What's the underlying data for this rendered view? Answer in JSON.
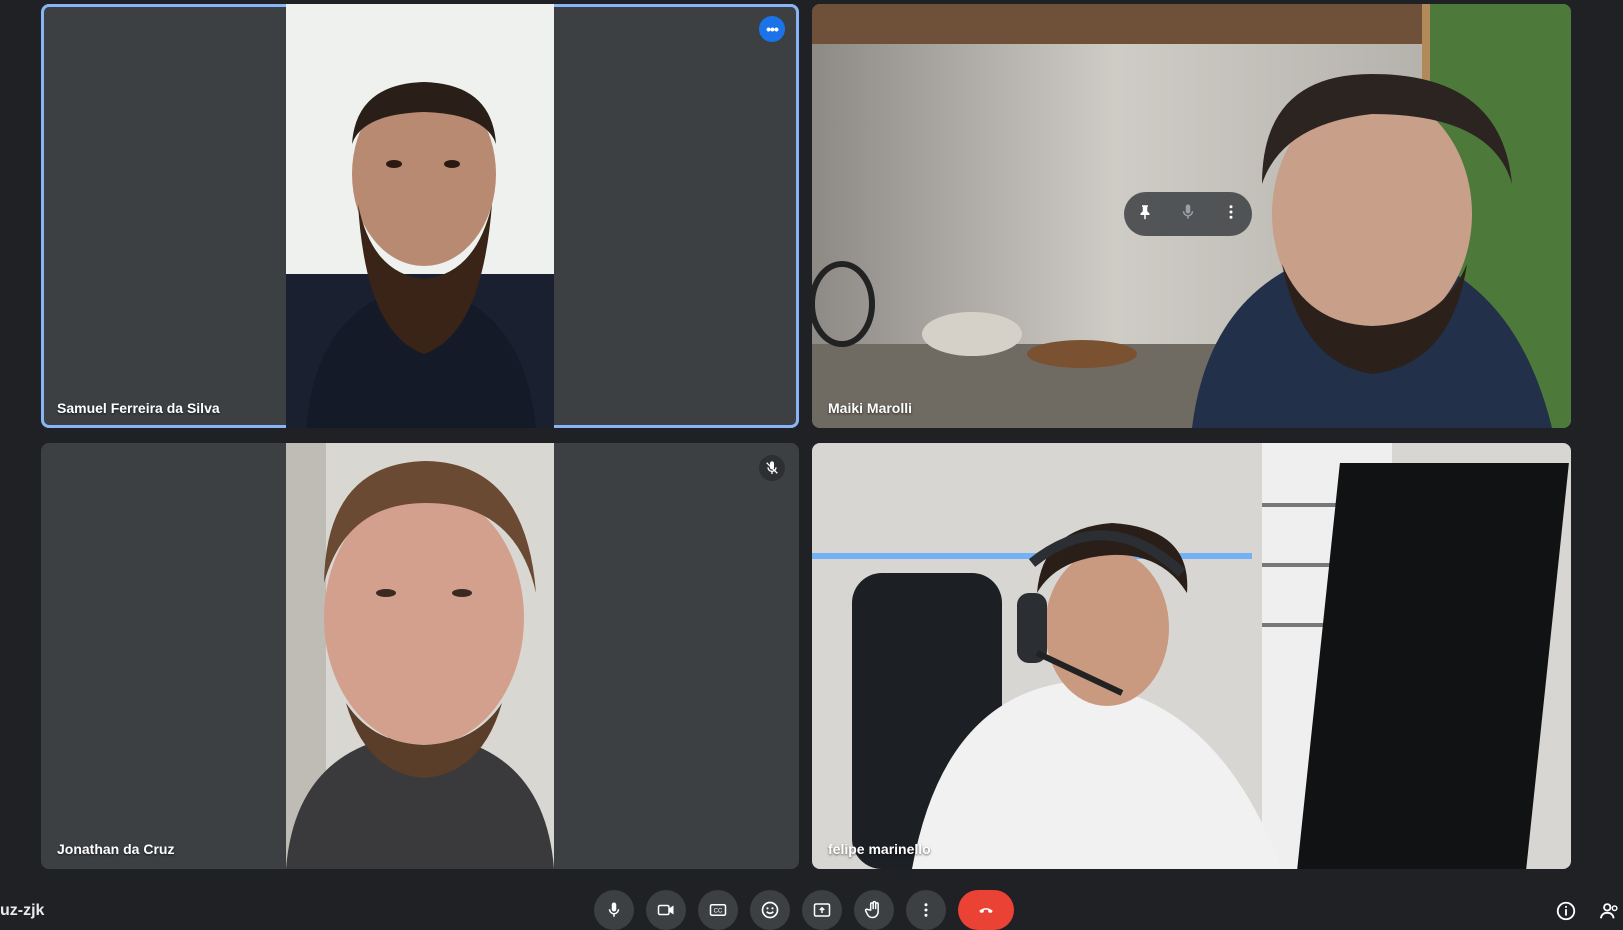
{
  "meeting": {
    "code_suffix": "uz-zjk"
  },
  "participants": [
    {
      "name": "Samuel Ferreira da Silva",
      "active_speaker": true,
      "more_options": "•••"
    },
    {
      "name": "Maiki Marolli"
    },
    {
      "name": "Jonathan da Cruz",
      "muted": true
    },
    {
      "name": "felipe marinello"
    }
  ],
  "tile_hover_actions": [
    "pin-icon",
    "mic-icon",
    "more-vert-icon"
  ],
  "controls": [
    "mic-icon",
    "camera-icon",
    "captions-icon",
    "emoji-icon",
    "present-icon",
    "raise-hand-icon",
    "more-vert-icon",
    "end-call-icon"
  ],
  "right_controls": [
    "info-icon",
    "people-icon"
  ],
  "colors": {
    "background": "#202124",
    "tile": "#3c4043",
    "accent": "#1a73e8",
    "active_border": "#8ab4f8",
    "end_call": "#ea4335"
  }
}
